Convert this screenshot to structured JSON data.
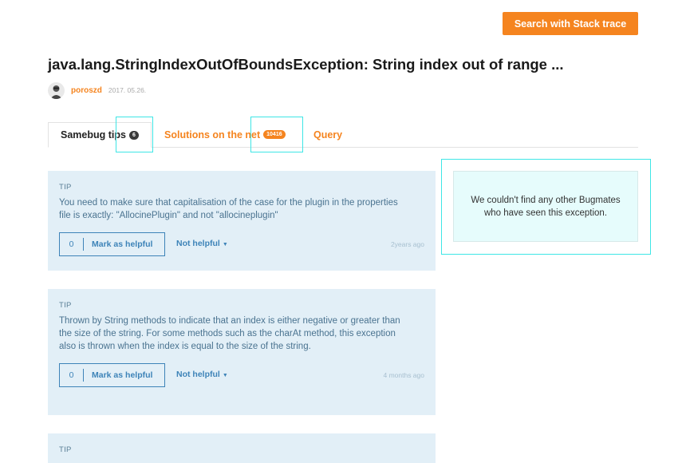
{
  "header": {
    "search_button": "Search with Stack trace"
  },
  "question": {
    "title": "java.lang.StringIndexOutOfBoundsException: String index out of range ...",
    "author": "poroszd",
    "date": "2017. 05.26."
  },
  "tabs": [
    {
      "label": "Samebug tips",
      "count": "6"
    },
    {
      "label": "Solutions on the net",
      "count": "10416"
    },
    {
      "label": "Query"
    }
  ],
  "tips": [
    {
      "label": "TIP",
      "body": "You need to make sure that capitalisation of the case for the plugin in the properties file is exactly: \"AllocinePlugin\" and not \"allocineplugin\"",
      "helpful_count": "0",
      "helpful_label": "Mark as helpful",
      "not_helpful_label": "Not helpful",
      "time": "2years ago"
    },
    {
      "label": "TIP",
      "body": "Thrown by String methods to indicate that an index is either negative or greater than the size of the string. For some methods such as the charAt method, this exception also is thrown when the index is equal to the size of the string.",
      "helpful_count": "0",
      "helpful_label": "Mark as helpful",
      "not_helpful_label": "Not helpful",
      "time": "4 months ago"
    },
    {
      "label": "TIP"
    }
  ],
  "sidebar": {
    "bugmates_message": "We couldn't find any other Bugmates who have seen this exception."
  },
  "colors": {
    "accent": "#f5841f",
    "tip_background": "#e2eff7",
    "link_blue": "#3d83b8",
    "highlight": "#3ee6e6"
  }
}
